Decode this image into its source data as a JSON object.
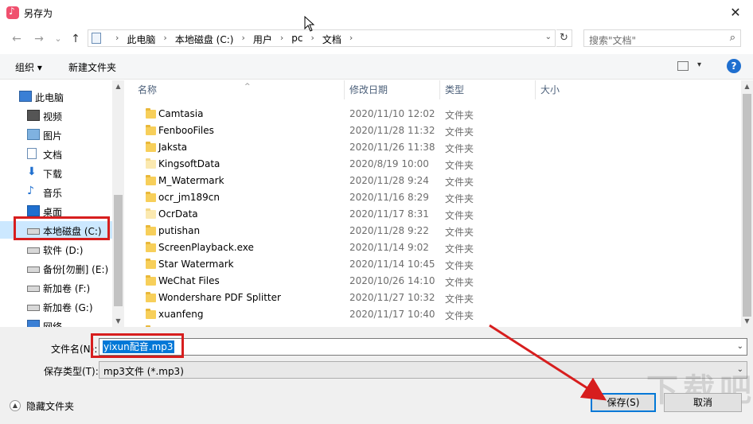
{
  "window": {
    "title": "另存为",
    "close": "✕"
  },
  "nav": {
    "back": "←",
    "forward": "→",
    "dropdown": "⌄",
    "up": "↑",
    "breadcrumbs": [
      "此电脑",
      "本地磁盘 (C:)",
      "用户",
      "pc",
      "文档"
    ],
    "refresh": "↻",
    "search_placeholder": "搜索\"文档\""
  },
  "toolbar": {
    "organize": "组织 ▾",
    "new_folder": "新建文件夹",
    "help": "?"
  },
  "sidebar": {
    "items": [
      {
        "label": "此电脑",
        "icon": "computer-icon"
      },
      {
        "label": "视频",
        "icon": "video-icon"
      },
      {
        "label": "图片",
        "icon": "pictures-icon"
      },
      {
        "label": "文档",
        "icon": "documents-icon"
      },
      {
        "label": "下载",
        "icon": "download-icon"
      },
      {
        "label": "音乐",
        "icon": "music-icon"
      },
      {
        "label": "桌面",
        "icon": "desktop-icon"
      },
      {
        "label": "本地磁盘 (C:)",
        "icon": "drive-icon",
        "selected": true
      },
      {
        "label": "软件 (D:)",
        "icon": "drive-icon"
      },
      {
        "label": "备份[勿删] (E:)",
        "icon": "drive-icon"
      },
      {
        "label": "新加卷 (F:)",
        "icon": "drive-icon"
      },
      {
        "label": "新加卷 (G:)",
        "icon": "drive-icon"
      },
      {
        "label": "网络",
        "icon": "network-icon"
      }
    ]
  },
  "columns": {
    "name": "名称",
    "modified": "修改日期",
    "type": "类型",
    "size": "大小"
  },
  "files": [
    {
      "name": "Camtasia",
      "date": "2020/11/10 12:02",
      "type": "文件夹"
    },
    {
      "name": "FenbooFiles",
      "date": "2020/11/28 11:32",
      "type": "文件夹"
    },
    {
      "name": "Jaksta",
      "date": "2020/11/26 11:38",
      "type": "文件夹"
    },
    {
      "name": "KingsoftData",
      "date": "2020/8/19 10:00",
      "type": "文件夹"
    },
    {
      "name": "M_Watermark",
      "date": "2020/11/28 9:24",
      "type": "文件夹"
    },
    {
      "name": "ocr_jm189cn",
      "date": "2020/11/16 8:29",
      "type": "文件夹"
    },
    {
      "name": "OcrData",
      "date": "2020/11/17 8:31",
      "type": "文件夹"
    },
    {
      "name": "putishan",
      "date": "2020/11/28 9:22",
      "type": "文件夹"
    },
    {
      "name": "ScreenPlayback.exe",
      "date": "2020/11/14 9:02",
      "type": "文件夹"
    },
    {
      "name": "Star Watermark",
      "date": "2020/11/14 10:45",
      "type": "文件夹"
    },
    {
      "name": "WeChat Files",
      "date": "2020/10/26 14:10",
      "type": "文件夹"
    },
    {
      "name": "Wondershare PDF Splitter",
      "date": "2020/11/27 10:32",
      "type": "文件夹"
    },
    {
      "name": "xuanfeng",
      "date": "2020/11/17 10:40",
      "type": "文件夹"
    },
    {
      "name": "",
      "date": "",
      "type": ""
    }
  ],
  "form": {
    "filename_label": "文件名(N):",
    "filename_value": "yixun配音.mp3",
    "filetype_label": "保存类型(T):",
    "filetype_value": "mp3文件 (*.mp3)",
    "hide_folders": "隐藏文件夹",
    "save": "保存(S)",
    "cancel": "取消"
  },
  "colors": {
    "accent": "#0078d7",
    "highlight": "#d71e1e",
    "selection": "#cce8ff"
  }
}
